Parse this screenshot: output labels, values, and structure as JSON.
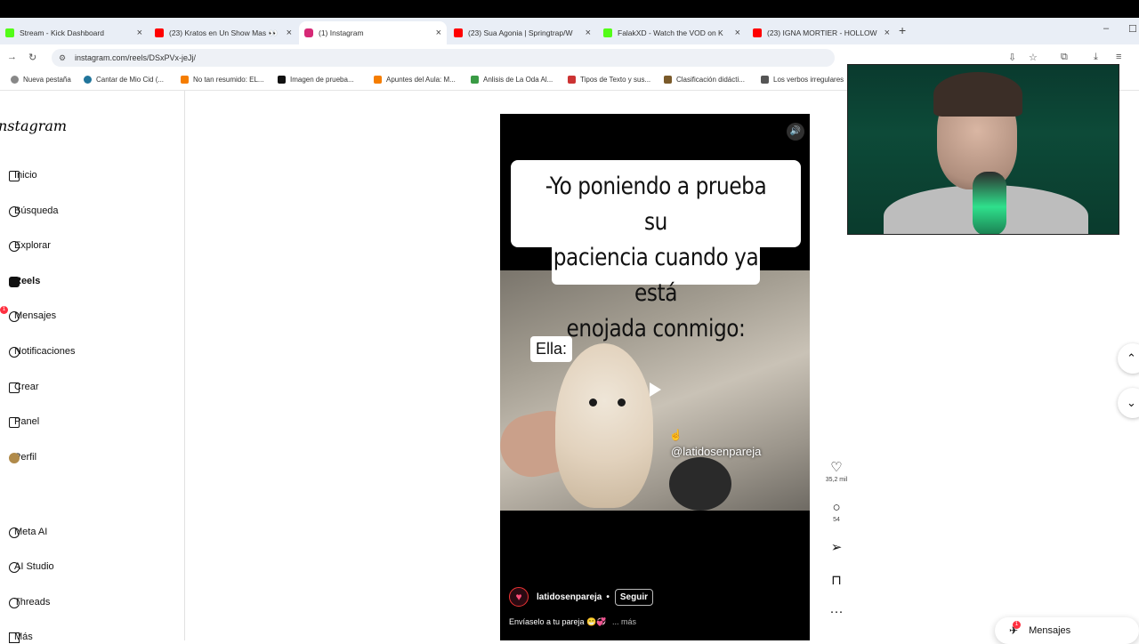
{
  "browser": {
    "tabs": [
      {
        "title": "Stream - Kick Dashboard",
        "icon": "kick-icon",
        "color": "#53fc18"
      },
      {
        "title": "(23) Kratos en Un Show Mas 👀",
        "icon": "youtube-icon",
        "color": "#ff0000"
      },
      {
        "title": "(1) Instagram",
        "icon": "instagram-icon",
        "color": "#d62976"
      },
      {
        "title": "(23) Sua Agonia | Springtrap/W",
        "icon": "youtube-icon",
        "color": "#ff0000"
      },
      {
        "title": "FalakXD - Watch the VOD on K",
        "icon": "kick-icon",
        "color": "#53fc18"
      },
      {
        "title": "(23) IGNA MORTIER - HOLLOW",
        "icon": "youtube-icon",
        "color": "#ff0000"
      }
    ],
    "url": "instagram.com/reels/DSxPVx-jeJj/",
    "bookmarks": [
      {
        "label": "Nueva pestaña",
        "icon": "globe-icon"
      },
      {
        "label": "Cantar de Mio Cid (...",
        "icon": "wordpress-icon"
      },
      {
        "label": "No tan resumido: EL...",
        "icon": "blogger-icon"
      },
      {
        "label": "Imagen de prueba...",
        "icon": "m-icon"
      },
      {
        "label": "Apuntes del Aula: M...",
        "icon": "blogger-icon"
      },
      {
        "label": "Anlisis de La Oda Al...",
        "icon": "doc-icon"
      },
      {
        "label": "Tipos de Texto y sus...",
        "icon": "doc-icon"
      },
      {
        "label": "Clasificación didácti...",
        "icon": "doc-icon"
      },
      {
        "label": "Los verbos irregulares",
        "icon": "doc-icon"
      }
    ]
  },
  "sidebar": {
    "logo": "nstagram",
    "items": [
      {
        "label": "Inicio",
        "icon": "home-icon"
      },
      {
        "label": "Búsqueda",
        "icon": "search-icon"
      },
      {
        "label": "Explorar",
        "icon": "compass-icon"
      },
      {
        "label": "Reels",
        "icon": "reels-icon"
      },
      {
        "label": "Mensajes",
        "icon": "messenger-icon"
      },
      {
        "label": "Notificaciones",
        "icon": "heart-icon"
      },
      {
        "label": "Crear",
        "icon": "plus-icon"
      },
      {
        "label": "Panel",
        "icon": "chart-icon"
      },
      {
        "label": "Perfil",
        "icon": "avatar-icon"
      },
      {
        "label": "Meta AI",
        "icon": "meta-ai-icon"
      },
      {
        "label": "AI Studio",
        "icon": "ai-studio-icon"
      },
      {
        "label": "Threads",
        "icon": "threads-icon"
      },
      {
        "label": "Más",
        "icon": "menu-icon"
      }
    ],
    "messages_badge": "1"
  },
  "reel": {
    "caption_lines": [
      "-Yo poniendo a prueba su",
      "paciencia cuando ya está",
      "enojada conmigo:"
    ],
    "sticker": "Ella:",
    "watermark": "@latidosenpareja",
    "username": "latidosenpareja",
    "follow_label": "Seguir",
    "description": "Envíaselo a tu pareja 😁💞",
    "more_label": "... más",
    "likes": "35,2 mil",
    "comments": "54"
  },
  "messages_button": {
    "label": "Mensajes",
    "badge": "1"
  }
}
